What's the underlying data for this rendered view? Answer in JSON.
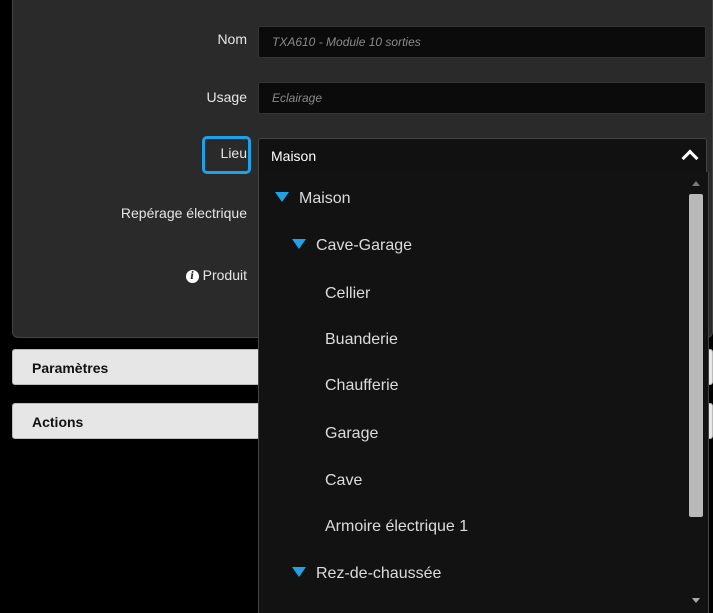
{
  "form": {
    "nom_label": "Nom",
    "nom_value": "TXA610 - Module 10 sorties",
    "usage_label": "Usage",
    "usage_value": "Eclairage",
    "lieu_label": "Lieu",
    "lieu_value": "Maison",
    "reperage_label": "Repérage électrique",
    "produit_label": "Produit",
    "produit_icon": "info-icon"
  },
  "sections": {
    "parametres": "Paramètres",
    "actions": "Actions"
  },
  "dropdown": {
    "items": [
      {
        "label": "Maison",
        "level": 0,
        "expanded": true
      },
      {
        "label": "Cave-Garage",
        "level": 1,
        "expanded": true
      },
      {
        "label": "Cellier",
        "level": 2
      },
      {
        "label": "Buanderie",
        "level": 2
      },
      {
        "label": "Chaufferie",
        "level": 2
      },
      {
        "label": "Garage",
        "level": 2
      },
      {
        "label": "Cave",
        "level": 2
      },
      {
        "label": "Armoire électrique 1",
        "level": 2
      },
      {
        "label": "Rez-de-chaussée",
        "level": 1,
        "expanded": true
      }
    ]
  },
  "colors": {
    "accent": "#1ea1e6",
    "background": "#000000",
    "panel": "#2a2a2a"
  }
}
